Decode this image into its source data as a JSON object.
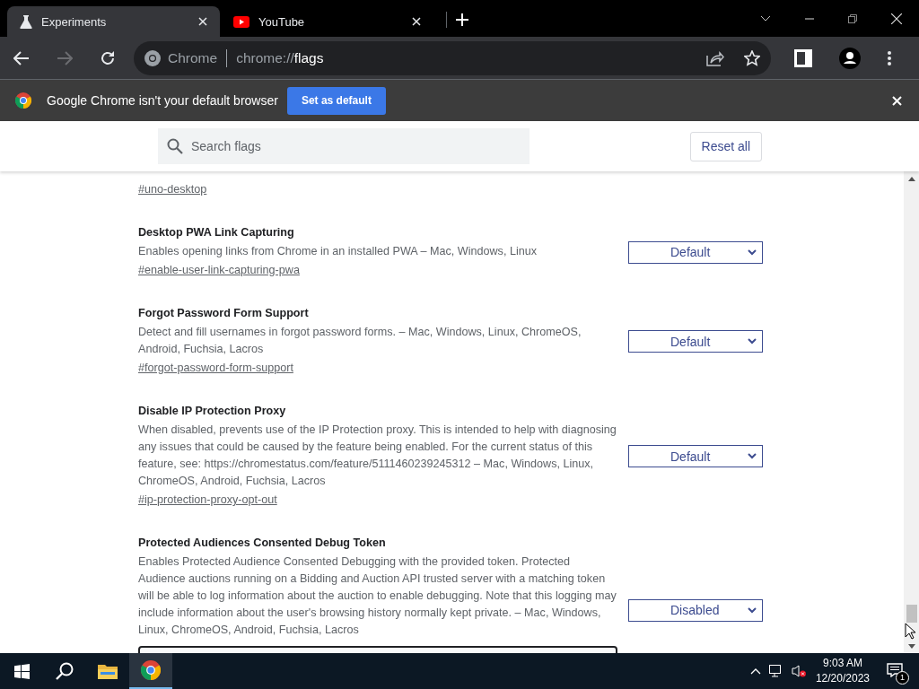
{
  "tabs": [
    {
      "title": "Experiments",
      "kind": "flask",
      "selected": true
    },
    {
      "title": "YouTube",
      "kind": "video",
      "selected": false
    }
  ],
  "toolbar": {
    "forward_disabled": true,
    "site_label": "Chrome",
    "url_scheme": "chrome://",
    "url_path": "flags"
  },
  "infobar": {
    "message": "Google Chrome isn't your default browser",
    "button": "Set as default"
  },
  "flags_header": {
    "search": {
      "placeholder": "Search flags"
    },
    "reset_button": "Reset all"
  },
  "flags": [
    {
      "link": "#uno-desktop"
    },
    {
      "title": "Desktop PWA Link Capturing",
      "description": "Enables opening links from Chrome in an installed PWA – Mac, Windows, Linux",
      "link": "#enable-user-link-capturing-pwa",
      "option": "Default"
    },
    {
      "title": "Forgot Password Form Support",
      "description": "Detect and fill usernames in forgot password forms. – Mac, Windows, Linux, ChromeOS, Android, Fuchsia, Lacros",
      "link": "#forgot-password-form-support",
      "option": "Default"
    },
    {
      "title": "Disable IP Protection Proxy",
      "description": "When disabled, prevents use of the IP Protection proxy. This is intended to help with diagnosing any issues that could be caused by the feature being enabled. For the current status of this feature, see: https://chromestatus.com/feature/5111460239245312 – Mac, Windows, Linux, ChromeOS, Android, Fuchsia, Lacros",
      "link": "#ip-protection-proxy-opt-out",
      "option": "Default"
    },
    {
      "title": "Protected Audiences Consented Debug Token",
      "description": "Enables Protected Audience Consented Debugging with the provided token. Protected Audience auctions running on a Bidding and Auction API trusted server with a matching token will be able to log information about the auction to enable debugging. Note that this logging may include information about the user's browsing history normally kept private. – Mac, Windows, Linux, ChromeOS, Android, Fuchsia, Lacros",
      "option": "Disabled",
      "token_field": true
    }
  ],
  "taskbar": {
    "time": "9:03 AM",
    "date": "12/20/2023",
    "notification_count": "1"
  }
}
